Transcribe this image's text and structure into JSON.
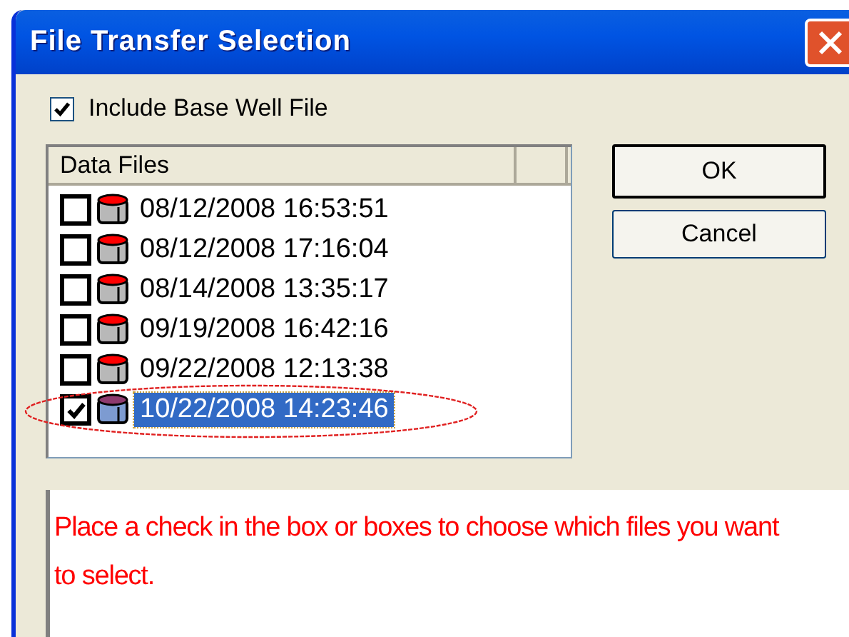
{
  "window": {
    "title": "File Transfer Selection"
  },
  "include_base": {
    "label": "Include Base Well File",
    "checked": true
  },
  "list": {
    "header": "Data Files"
  },
  "files": [
    {
      "label": "08/12/2008  16:53:51",
      "checked": false,
      "selected": false
    },
    {
      "label": "08/12/2008  17:16:04",
      "checked": false,
      "selected": false
    },
    {
      "label": "08/14/2008  13:35:17",
      "checked": false,
      "selected": false
    },
    {
      "label": "09/19/2008  16:42:16",
      "checked": false,
      "selected": false
    },
    {
      "label": "09/22/2008  12:13:38",
      "checked": false,
      "selected": false
    },
    {
      "label": "10/22/2008  14:23:46",
      "checked": true,
      "selected": true
    }
  ],
  "buttons": [
    {
      "label": "OK",
      "default": true
    },
    {
      "label": "Cancel",
      "default": false
    }
  ],
  "instructions": "Place a check in the box or boxes to choose which files you want to select."
}
